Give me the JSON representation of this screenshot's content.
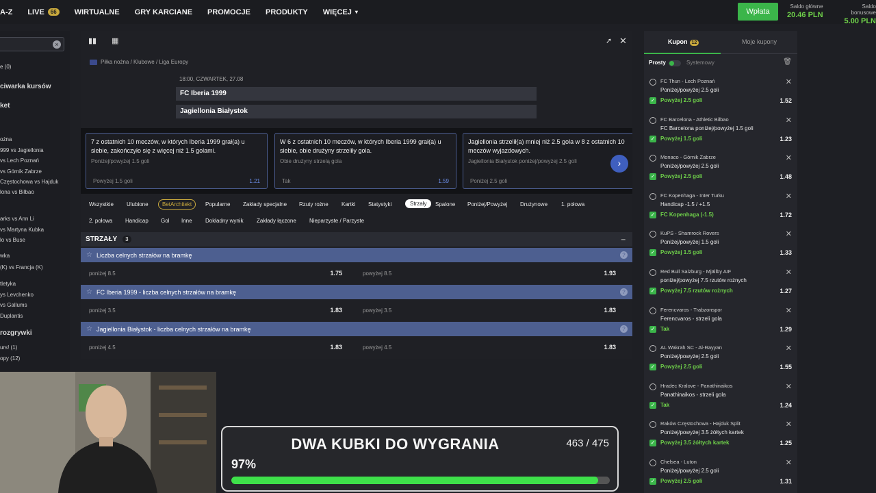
{
  "nav": {
    "items": [
      "A-Z",
      "LIVE",
      "WIRTUALNE",
      "GRY KARCIANE",
      "PROMOCJE",
      "PRODUKTY",
      "WIĘCEJ"
    ],
    "live_badge": "66",
    "deposit": "Wpłata",
    "balance_main_label": "Saldo główne",
    "balance_main": "20.46 PLN",
    "balance_bonus_label": "Saldo bonusowe",
    "balance_bonus": "5.00 PLN"
  },
  "sidebar": {
    "lines": [
      {
        "t": "e (0)",
        "k": "s"
      },
      {
        "t": "ciwarka kursów",
        "k": "b"
      },
      {
        "t": "ket",
        "k": "b"
      },
      {
        "t": "ożna",
        "k": "s"
      },
      {
        "t": "999 vs Jagiellonia",
        "k": "s"
      },
      {
        "t": "vs Lech Poznań",
        "k": "s"
      },
      {
        "t": "vs Górnik Zabrze",
        "k": "s"
      },
      {
        "t": "Częstochowa vs Hajduk",
        "k": "s"
      },
      {
        "t": "lona vs Bilbao",
        "k": "s"
      },
      {
        "t": "arks vs Ann Li",
        "k": "s"
      },
      {
        "t": "vs Martyna Kubka",
        "k": "s"
      },
      {
        "t": "lo vs Buse",
        "k": "s"
      },
      {
        "t": "wka",
        "k": "s"
      },
      {
        "t": "(K) vs Francja (K)",
        "k": "s"
      },
      {
        "t": "tletyka",
        "k": "s"
      },
      {
        "t": "ys Levchenko",
        "k": "s"
      },
      {
        "t": "vs Gallums",
        "k": "s"
      },
      {
        "t": "Duplantis",
        "k": "s"
      },
      {
        "t": "rozgrywki",
        "k": "b"
      },
      {
        "t": "urs! (1)",
        "k": "s"
      },
      {
        "t": "opy (12)",
        "k": "s"
      }
    ]
  },
  "event": {
    "breadcrumb": "Piłka nożna / Klubowe / Liga Europy",
    "datetime": "18:00, CZWARTEK, 27.08",
    "home": "FC Iberia 1999",
    "away": "Jagiellonia Białystok"
  },
  "stats": [
    {
      "text": "7 z ostatnich 10 meczów, w których Iberia 1999 grał(a) u siebie, zakończyło się z więcej niż 1.5 golami.",
      "sub": "Poniżej/powyżej 1.5 goli",
      "pick": "Powyżej 1.5 goli",
      "odd": "1.21"
    },
    {
      "text": "W 6 z ostatnich 10 meczów, w których Iberia 1999 grał(a) u siebie, obie drużyny strzeliły gola.",
      "sub": "Obie drużyny strzelą gola",
      "pick": "Tak",
      "odd": "1.59"
    },
    {
      "text": "Jagiellonia strzelił(a) mniej niż 2.5 gola w 8 z ostatnich 10 meczów wyjazdowych.",
      "sub": "Jagiellonia Białystok poniżej/powyżej 2.5 goli",
      "pick": "Poniżej 2.5 goli",
      "odd": "1."
    }
  ],
  "filters": {
    "row1": [
      "Wszystkie",
      "Ulubione",
      "BetArchitekt",
      "Popularne",
      "Zakłady specjalne",
      "Rzuty rożne",
      "Kartki",
      "Statystyki",
      "Strzały",
      "Spalone",
      "Poniżej/Powyżej",
      "Drużynowe",
      "1. połowa"
    ],
    "row2": [
      "2. połowa",
      "Handicap",
      "Gol",
      "Inne",
      "Dokładny wynik",
      "Zakłady łączone",
      "Nieparzyste / Parzyste"
    ]
  },
  "section": {
    "title": "STRZAŁY",
    "count": "3"
  },
  "markets": [
    {
      "name": "Liczba celnych strzałów na bramkę",
      "left": "poniżej 8.5",
      "left_odd": "1.75",
      "right": "powyżej 8.5",
      "right_odd": "1.93"
    },
    {
      "name": "FC Iberia 1999 - liczba celnych strzałów na bramkę",
      "left": "poniżej 3.5",
      "left_odd": "1.83",
      "right": "powyżej 3.5",
      "right_odd": "1.83"
    },
    {
      "name": "Jagiellonia Białystok - liczba celnych strzałów na bramkę",
      "left": "poniżej 4.5",
      "left_odd": "1.83",
      "right": "powyżej 4.5",
      "right_odd": "1.83"
    }
  ],
  "coupon": {
    "tab_coupon": "Kupon",
    "tab_badge": "12",
    "tab_my": "Moje kupony",
    "mode_simple": "Prosty",
    "mode_system": "Systemowy",
    "bets": [
      {
        "match": "FC Thun - Lech Poznań",
        "market": "Poniżej/powyżej 2.5 goli",
        "selection": "Powyżej 2.5 goli",
        "odd": "1.52"
      },
      {
        "match": "FC Barcelona - Athletic Bilbao",
        "market": "FC Barcelona poniżej/powyżej 1.5 goli",
        "selection": "Powyżej 1.5 goli",
        "odd": "1.23"
      },
      {
        "match": "Monaco - Górnik Zabrze",
        "market": "Poniżej/powyżej 2.5 goli",
        "selection": "Powyżej 2.5 goli",
        "odd": "1.48"
      },
      {
        "match": "FC Kopenhaga - Inter Turku",
        "market": "Handicap -1.5 / +1.5",
        "selection": "FC Kopenhaga (-1.5)",
        "odd": "1.72"
      },
      {
        "match": "KuPS - Shamrock Rovers",
        "market": "Poniżej/powyżej 1.5 goli",
        "selection": "Powyżej 1.5 goli",
        "odd": "1.33"
      },
      {
        "match": "Red Bull Salzburg - Mjällby AIF",
        "market": "poniżej/powyżej 7.5 rzutów rożnych",
        "selection": "Powyżej 7.5 rzutów rożnych",
        "odd": "1.27"
      },
      {
        "match": "Ferencvaros - Trabzonspor",
        "market": "Ferencvaros - strzeli gola",
        "selection": "Tak",
        "odd": "1.29"
      },
      {
        "match": "AL Wakrah SC - Al-Rayyan",
        "market": "Poniżej/powyżej 2.5 goli",
        "selection": "Powyżej 2.5 goli",
        "odd": "1.55"
      },
      {
        "match": "Hradec Kralove - Panathinaikos",
        "market": "Panathinaikos - strzeli gola",
        "selection": "Tak",
        "odd": "1.24"
      },
      {
        "match": "Raków Częstochowa - Hajduk Split",
        "market": "Poniżej/powyżej 3.5 żółtych kartek",
        "selection": "Powyżej 3.5 żółtych kartek",
        "odd": "1.25"
      },
      {
        "match": "Chelsea - Luton",
        "market": "Poniżej/powyżej 2.5 goli",
        "selection": "Powyżej 2.5 goli",
        "odd": "1.31"
      }
    ]
  },
  "goal": {
    "title": "DWA KUBKI DO WYGRANIA",
    "count": "463 / 475",
    "percent": "97%",
    "progress": 0.97
  }
}
